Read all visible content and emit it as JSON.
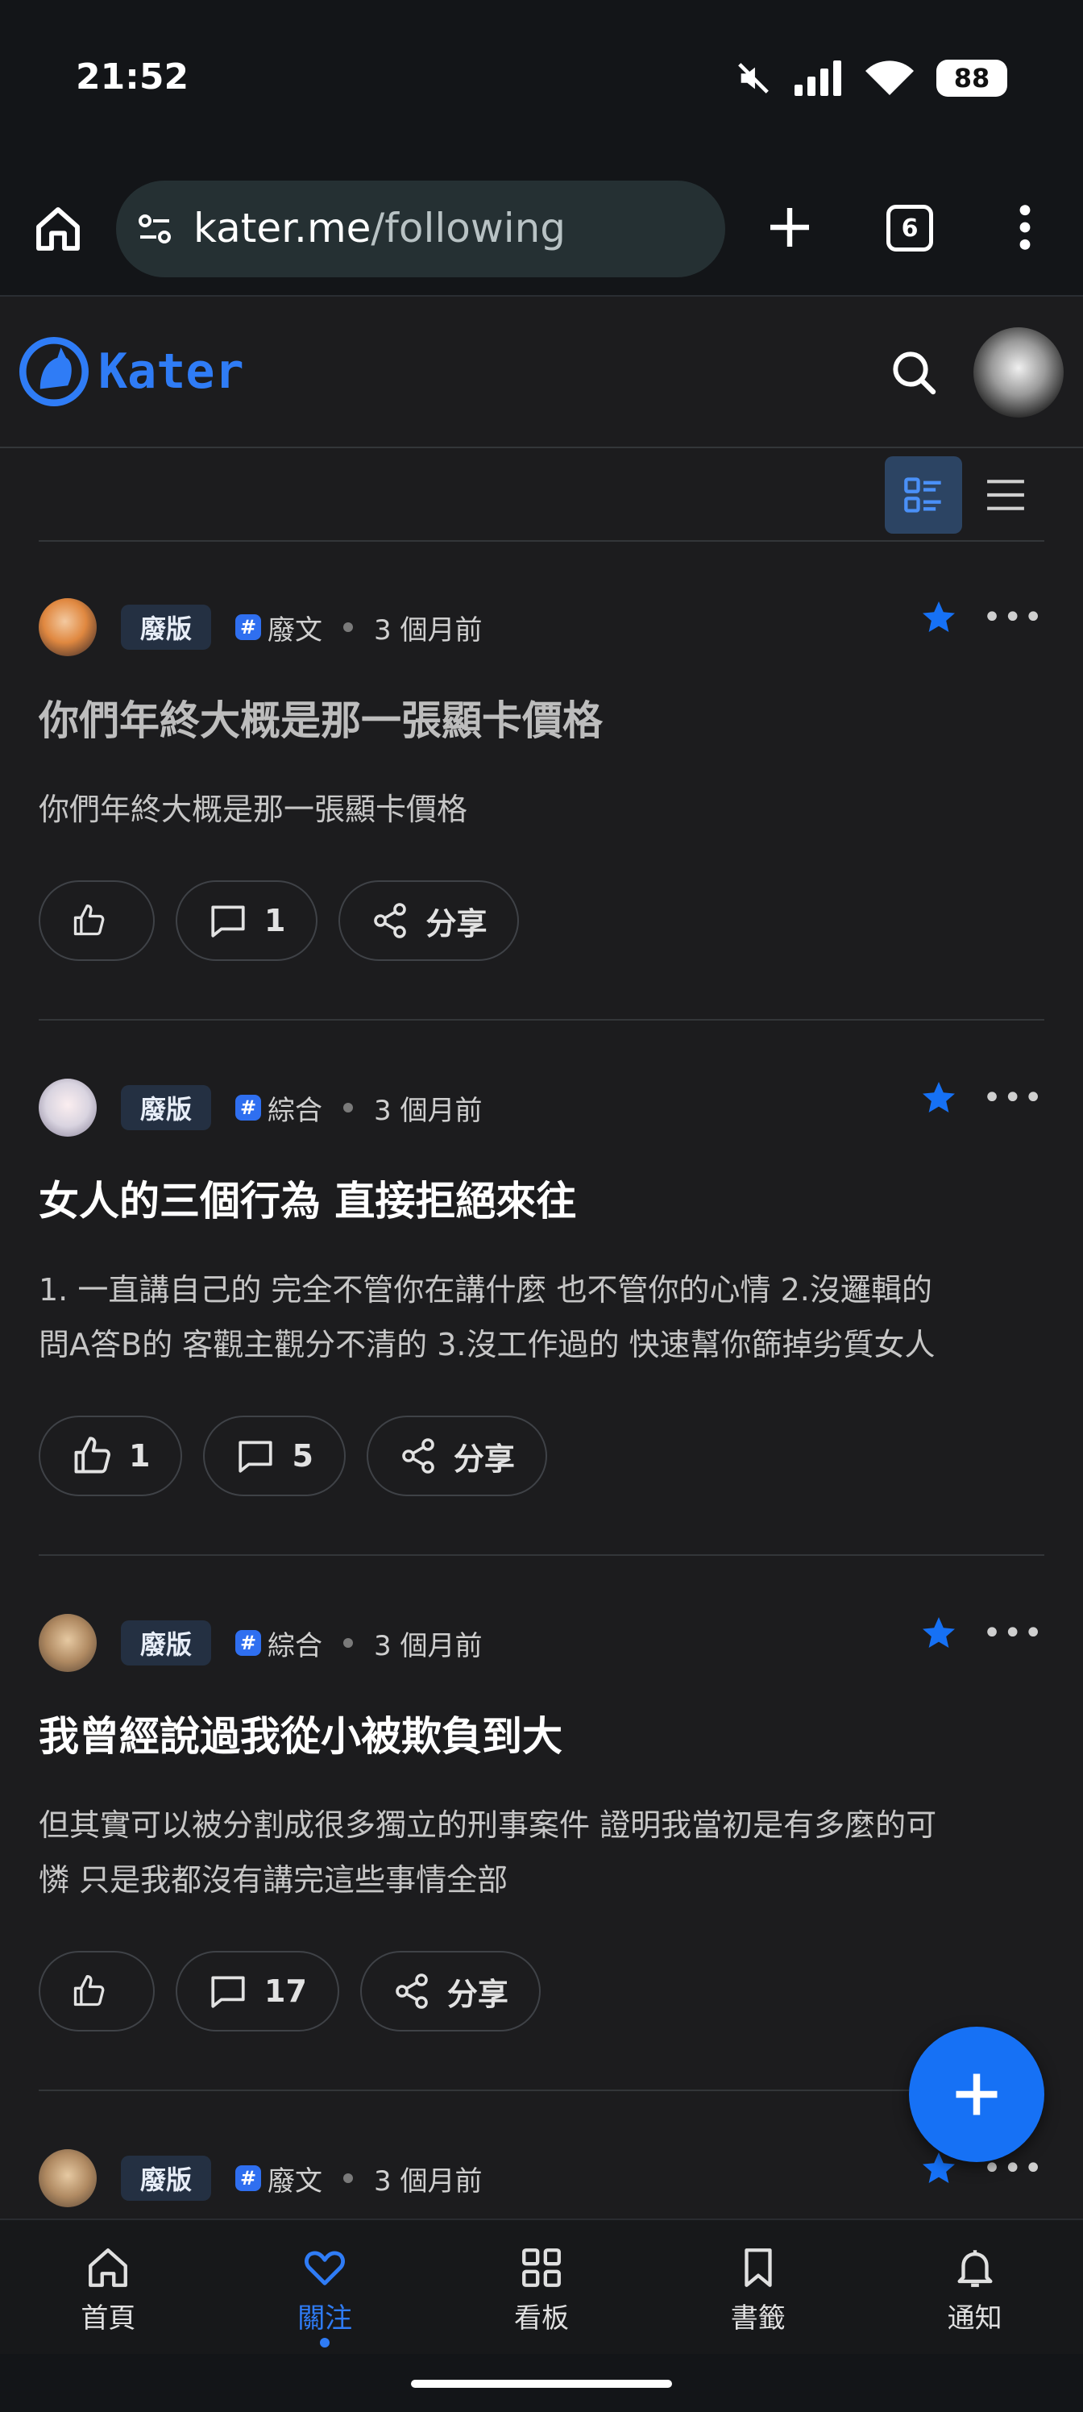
{
  "status": {
    "time": "21:52",
    "battery": "88"
  },
  "browser": {
    "url_host": "kater.me",
    "url_path": "/following",
    "tab_count": "6"
  },
  "site": {
    "logo_text": "Kater"
  },
  "colors": {
    "accent": "#2f7cf6",
    "fab": "#1671f5",
    "background": "#1c1c1e",
    "chip": "#243042"
  },
  "posts": [
    {
      "board": "廢版",
      "category": "廢文",
      "time": "3 個月前",
      "title": "你們年終大概是那一張顯卡價格",
      "body": "你們年終大概是那一張顯卡價格",
      "likes": "",
      "comments": "1",
      "share": "分享",
      "starred": true
    },
    {
      "board": "廢版",
      "category": "綜合",
      "time": "3 個月前",
      "title": "女人的三個行為 直接拒絕來往",
      "body_line1": "1. 一直講自己的 完全不管你在講什麼 也不管你的心情 2.沒邏輯的",
      "body_line2": "問A答B的 客觀主觀分不清的 3.沒工作過的 快速幫你篩掉劣質女人",
      "likes": "1",
      "comments": "5",
      "share": "分享",
      "starred": true
    },
    {
      "board": "廢版",
      "category": "綜合",
      "time": "3 個月前",
      "title": "我曾經說過我從小被欺負到大",
      "body_line1": "但其實可以被分割成很多獨立的刑事案件 證明我當初是有多麼的可",
      "body_line2": "憐 只是我都沒有講完這些事情全部",
      "likes": "",
      "comments": "17",
      "share": "分享",
      "starred": true
    },
    {
      "board": "廢版",
      "category": "廢文",
      "time": "3 個月前",
      "starred": true
    }
  ],
  "bottom_nav": [
    {
      "label": "首頁",
      "icon": "home-icon"
    },
    {
      "label": "關注",
      "icon": "heart-icon",
      "active": true
    },
    {
      "label": "看板",
      "icon": "grid-icon"
    },
    {
      "label": "書籤",
      "icon": "bookmark-icon"
    },
    {
      "label": "通知",
      "icon": "bell-icon"
    }
  ]
}
